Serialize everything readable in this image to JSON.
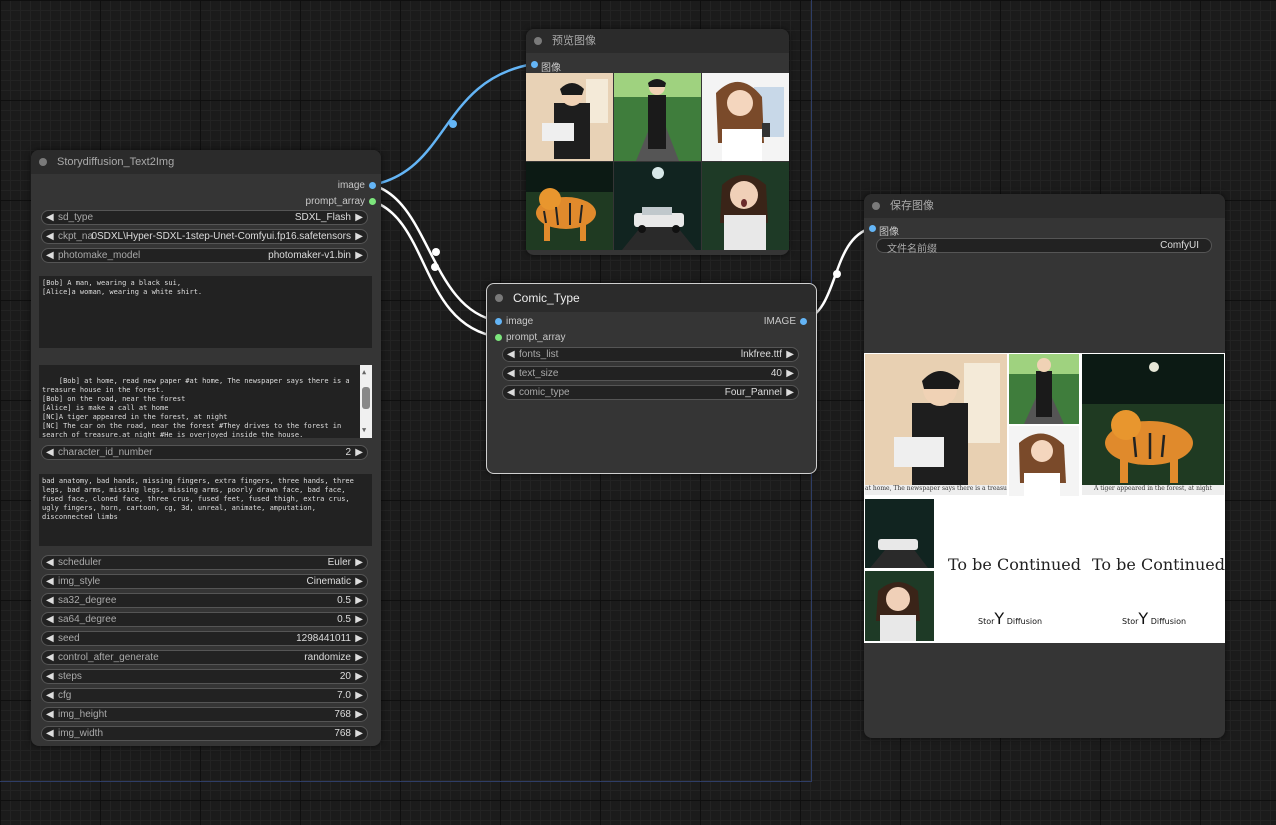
{
  "colors": {
    "canvas": "#1b1b1b",
    "node": "#353535",
    "title": "#2b2b2b",
    "wire_image": "#64b5f6",
    "wire_string": "#ffffff",
    "slot_image": "#64b5f6",
    "slot_string": "#7ce67c"
  },
  "storydiffusion": {
    "title": "Storydiffusion_Text2Img",
    "outputs": {
      "image": "image",
      "prompt_array": "prompt_array"
    },
    "sd_type": {
      "name": "sd_type",
      "value": "SDXL_Flash"
    },
    "ckpt_name": {
      "name": "ckpt_na",
      "value": "0SDXL\\Hyper-SDXL-1step-Unet-Comfyui.fp16.safetensors"
    },
    "photomake_model": {
      "name": "photomake_model",
      "value": "photomaker-v1.bin"
    },
    "character_prompt": "[Bob] A man, wearing a black sui,\n[Alice]a woman, wearing a white shirt.",
    "scene_prompt": "[Bob] at home, read new paper #at home, The newspaper says there is a treasure house in the forest.\n[Bob] on the road, near the forest\n[Alice] is make a call at home\n[NC]A tiger appeared in the forest, at night\n[NC] The car on the road, near the forest #They drives to the forest in search of treasure.at night #He is overjoyed inside the house.\n[Alice] very frightened, open mouth, in the forest, at night.",
    "character_id_number": {
      "name": "character_id_number",
      "value": "2"
    },
    "negative_prompt": "bad anatomy, bad hands, missing fingers, extra fingers, three hands, three legs, bad arms, missing legs, missing arms, poorly drawn face, bad face, fused face, cloned face, three crus, fused feet, fused thigh, extra crus, ugly fingers, horn, cartoon, cg, 3d, unreal, animate, amputation, disconnected limbs",
    "params": [
      {
        "name": "scheduler",
        "value": "Euler"
      },
      {
        "name": "img_style",
        "value": "Cinematic"
      },
      {
        "name": "sa32_degree",
        "value": "0.5"
      },
      {
        "name": "sa64_degree",
        "value": "0.5"
      },
      {
        "name": "seed",
        "value": "1298441011"
      },
      {
        "name": "control_after_generate",
        "value": "randomize"
      },
      {
        "name": "steps",
        "value": "20"
      },
      {
        "name": "cfg",
        "value": "7.0"
      },
      {
        "name": "img_height",
        "value": "768"
      },
      {
        "name": "img_width",
        "value": "768"
      }
    ]
  },
  "preview": {
    "title": "预览图像",
    "input": "图像"
  },
  "comic": {
    "title": "Comic_Type",
    "inputs": {
      "image": "image",
      "prompt_array": "prompt_array"
    },
    "output": "IMAGE",
    "fonts_list": {
      "name": "fonts_list",
      "value": "lnkfree.ttf"
    },
    "text_size": {
      "name": "text_size",
      "value": "40"
    },
    "comic_type": {
      "name": "comic_type",
      "value": "Four_Pannel"
    }
  },
  "save": {
    "title": "保存图像",
    "input": "图像",
    "filename_prefix": {
      "name": "文件名前缀",
      "value": "ComfyUI"
    },
    "captions": [
      "at home, The newspaper says there is a treasure house in the forest.",
      "A tiger appeared in the forest, at night"
    ],
    "to_be_continued": "To be Continued",
    "brand_left": "Stor",
    "brand_y": "Y",
    "brand_right": "Diffusion"
  },
  "icons": {
    "left_arrow": "◀",
    "right_arrow": "▶",
    "scroll_up": "▲",
    "scroll_down": "▼"
  }
}
